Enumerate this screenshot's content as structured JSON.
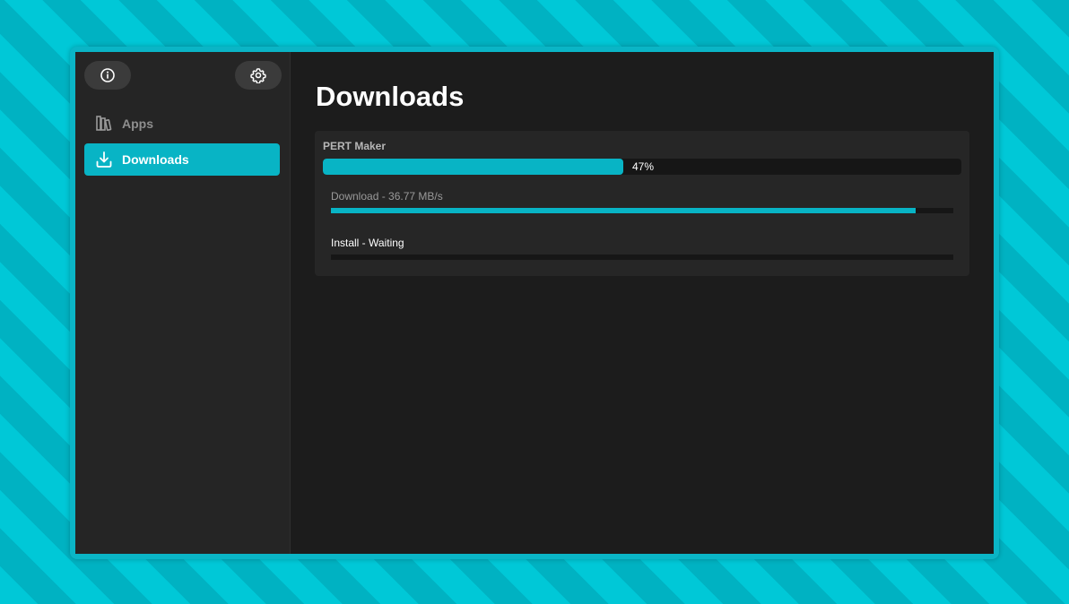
{
  "sidebar": {
    "info_icon": "info-icon",
    "settings_icon": "gear-icon",
    "items": [
      {
        "label": "Apps",
        "icon": "library-icon",
        "active": false
      },
      {
        "label": "Downloads",
        "icon": "download-icon",
        "active": true
      }
    ]
  },
  "main": {
    "title": "Downloads",
    "downloads": [
      {
        "app_name": "PERT Maker",
        "overall_progress": 0.47,
        "overall_label": "47%",
        "steps": [
          {
            "label": "Download - 36.77 MB/s",
            "progress": 0.94
          },
          {
            "label": "Install - Waiting",
            "progress": 0.0
          }
        ]
      }
    ]
  },
  "colors": {
    "accent": "#08b4c5",
    "background_stripe_light": "#00c8d7",
    "background_stripe_dark": "#00b2c2",
    "window_bg": "#1c1c1c",
    "sidebar_bg": "#252525",
    "card_bg": "#262626",
    "track_bg": "#161616"
  }
}
